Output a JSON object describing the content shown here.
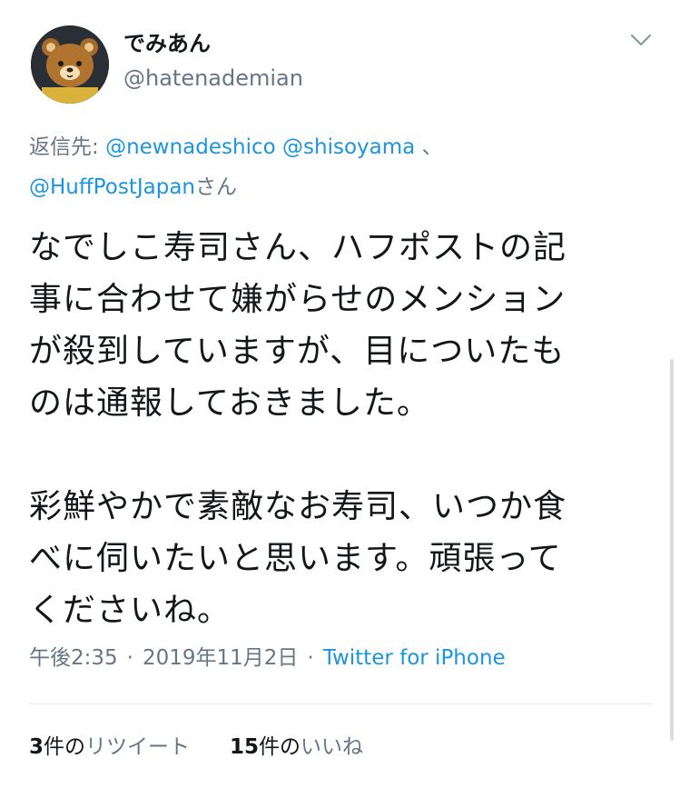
{
  "author": {
    "display_name": "でみあん",
    "handle": "@hatenademian"
  },
  "reply": {
    "prefix": "返信先: ",
    "mention1": "@newnadeshico",
    "mention2": "@shisoyama",
    "comma": " 、",
    "mention3": "@HuffPostJapan",
    "suffix": "さん"
  },
  "body": {
    "lines": [
      "なでしこ寿司さん、ハフポストの記",
      "事に合わせて嫌がらせのメンション",
      "が殺到していますが、目についたも",
      "のは通報しておきました。",
      "彩鮮やかで素敵なお寿司、いつか食",
      "べに伺いたいと思います。頑張って",
      "くださいね。"
    ]
  },
  "meta": {
    "time": "午後2:35",
    "date": "2019年11月2日",
    "separator": "·",
    "source": "Twitter for iPhone"
  },
  "stats": {
    "retweets_count": "3",
    "retweets_unit": "件の",
    "retweets_label": "リツイート",
    "likes_count": "15",
    "likes_unit": "件の",
    "likes_label": "いいね"
  },
  "icons": {
    "caret": "chevron-down-icon",
    "avatar": "bear-avatar"
  }
}
